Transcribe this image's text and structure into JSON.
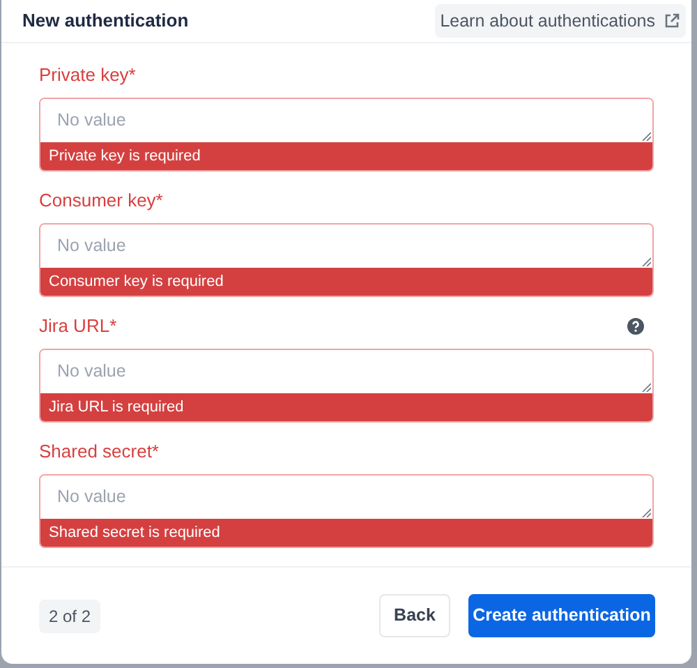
{
  "dialog": {
    "title": "New authentication",
    "help_link": "Learn about authentications"
  },
  "fields": [
    {
      "label": "Private key*",
      "placeholder": "No value",
      "error": "Private key is required",
      "help": false
    },
    {
      "label": "Consumer key*",
      "placeholder": "No value",
      "error": "Consumer key is required",
      "help": false
    },
    {
      "label": "Jira URL*",
      "placeholder": "No value",
      "error": "Jira URL is required",
      "help": true
    },
    {
      "label": "Shared secret*",
      "placeholder": "No value",
      "error": "Shared secret is required",
      "help": false
    }
  ],
  "footer": {
    "step": "2 of 2",
    "buttons": [
      {
        "label": "Back",
        "kind": "secondary"
      },
      {
        "label": "Create authentication",
        "kind": "primary"
      }
    ]
  }
}
